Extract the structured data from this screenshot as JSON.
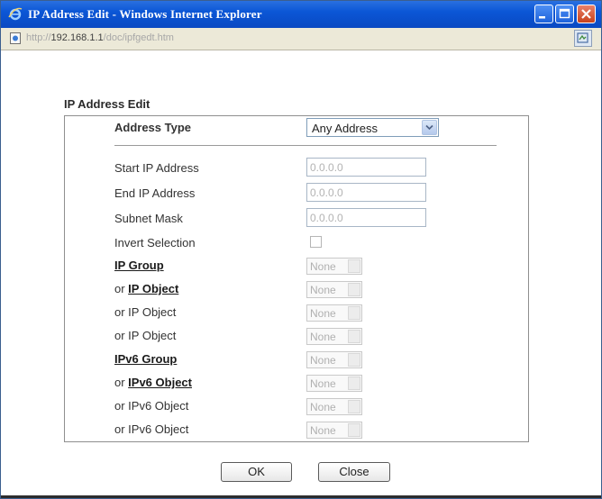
{
  "window": {
    "title": "IP Address Edit - Windows Internet Explorer",
    "url_prefix": "http://",
    "url_host": "192.168.1.1",
    "url_path": "/doc/ipfgedt.htm"
  },
  "dialog": {
    "section_title": "IP Address Edit",
    "address_type": {
      "label": "Address Type",
      "value": "Any Address"
    },
    "start_ip": {
      "label": "Start IP Address",
      "value": "0.0.0.0"
    },
    "end_ip": {
      "label": "End IP Address",
      "value": "0.0.0.0"
    },
    "subnet_mask": {
      "label": "Subnet Mask",
      "value": "0.0.0.0"
    },
    "invert_selection": {
      "label": "Invert Selection",
      "checked": false
    },
    "ip_group": {
      "label": "IP Group",
      "value": "None"
    },
    "ip_object_1": {
      "prefix": "or ",
      "label": "IP Object",
      "value": "None"
    },
    "ip_object_2": {
      "label": "or IP Object",
      "value": "None"
    },
    "ip_object_3": {
      "label": "or IP Object",
      "value": "None"
    },
    "ipv6_group": {
      "label": "IPv6 Group",
      "value": "None"
    },
    "ipv6_object_1": {
      "prefix": "or ",
      "label": "IPv6 Object",
      "value": "None"
    },
    "ipv6_object_2": {
      "label": "or IPv6 Object",
      "value": "None"
    },
    "ipv6_object_3": {
      "label": "or IPv6 Object",
      "value": "None"
    },
    "ok_label": "OK",
    "close_label": "Close"
  },
  "icons": [
    "ie-logo-icon",
    "page-icon",
    "minimize-icon",
    "maximize-icon",
    "close-icon",
    "compatibility-view-icon",
    "chevron-down-icon"
  ],
  "colors": {
    "titlebar": "#0b56d6",
    "close_button": "#c8421c",
    "panel_border": "#8f8f8f"
  }
}
